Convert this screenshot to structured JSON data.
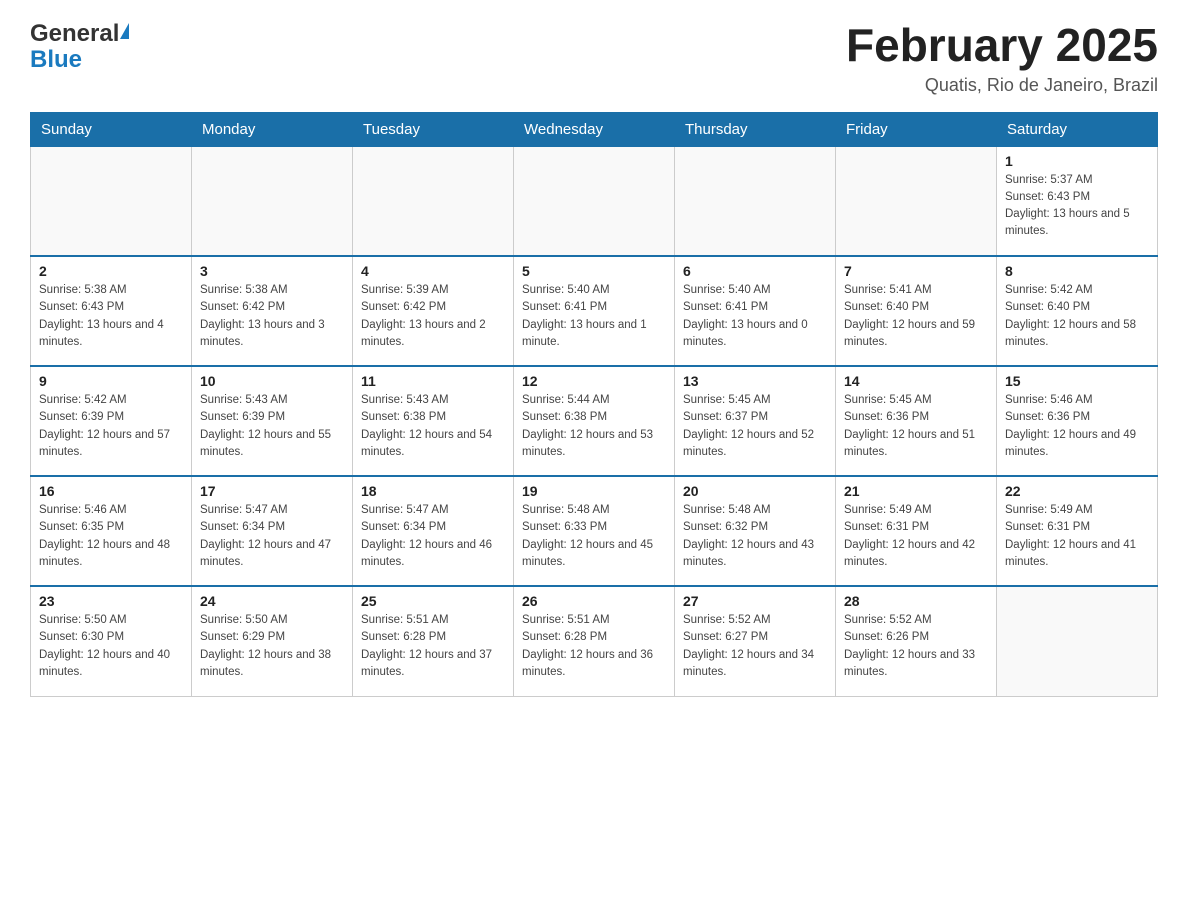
{
  "header": {
    "logo_general": "General",
    "logo_blue": "Blue",
    "month_title": "February 2025",
    "location": "Quatis, Rio de Janeiro, Brazil"
  },
  "days_of_week": [
    "Sunday",
    "Monday",
    "Tuesday",
    "Wednesday",
    "Thursday",
    "Friday",
    "Saturday"
  ],
  "weeks": [
    [
      {
        "day": "",
        "info": ""
      },
      {
        "day": "",
        "info": ""
      },
      {
        "day": "",
        "info": ""
      },
      {
        "day": "",
        "info": ""
      },
      {
        "day": "",
        "info": ""
      },
      {
        "day": "",
        "info": ""
      },
      {
        "day": "1",
        "info": "Sunrise: 5:37 AM\nSunset: 6:43 PM\nDaylight: 13 hours and 5 minutes."
      }
    ],
    [
      {
        "day": "2",
        "info": "Sunrise: 5:38 AM\nSunset: 6:43 PM\nDaylight: 13 hours and 4 minutes."
      },
      {
        "day": "3",
        "info": "Sunrise: 5:38 AM\nSunset: 6:42 PM\nDaylight: 13 hours and 3 minutes."
      },
      {
        "day": "4",
        "info": "Sunrise: 5:39 AM\nSunset: 6:42 PM\nDaylight: 13 hours and 2 minutes."
      },
      {
        "day": "5",
        "info": "Sunrise: 5:40 AM\nSunset: 6:41 PM\nDaylight: 13 hours and 1 minute."
      },
      {
        "day": "6",
        "info": "Sunrise: 5:40 AM\nSunset: 6:41 PM\nDaylight: 13 hours and 0 minutes."
      },
      {
        "day": "7",
        "info": "Sunrise: 5:41 AM\nSunset: 6:40 PM\nDaylight: 12 hours and 59 minutes."
      },
      {
        "day": "8",
        "info": "Sunrise: 5:42 AM\nSunset: 6:40 PM\nDaylight: 12 hours and 58 minutes."
      }
    ],
    [
      {
        "day": "9",
        "info": "Sunrise: 5:42 AM\nSunset: 6:39 PM\nDaylight: 12 hours and 57 minutes."
      },
      {
        "day": "10",
        "info": "Sunrise: 5:43 AM\nSunset: 6:39 PM\nDaylight: 12 hours and 55 minutes."
      },
      {
        "day": "11",
        "info": "Sunrise: 5:43 AM\nSunset: 6:38 PM\nDaylight: 12 hours and 54 minutes."
      },
      {
        "day": "12",
        "info": "Sunrise: 5:44 AM\nSunset: 6:38 PM\nDaylight: 12 hours and 53 minutes."
      },
      {
        "day": "13",
        "info": "Sunrise: 5:45 AM\nSunset: 6:37 PM\nDaylight: 12 hours and 52 minutes."
      },
      {
        "day": "14",
        "info": "Sunrise: 5:45 AM\nSunset: 6:36 PM\nDaylight: 12 hours and 51 minutes."
      },
      {
        "day": "15",
        "info": "Sunrise: 5:46 AM\nSunset: 6:36 PM\nDaylight: 12 hours and 49 minutes."
      }
    ],
    [
      {
        "day": "16",
        "info": "Sunrise: 5:46 AM\nSunset: 6:35 PM\nDaylight: 12 hours and 48 minutes."
      },
      {
        "day": "17",
        "info": "Sunrise: 5:47 AM\nSunset: 6:34 PM\nDaylight: 12 hours and 47 minutes."
      },
      {
        "day": "18",
        "info": "Sunrise: 5:47 AM\nSunset: 6:34 PM\nDaylight: 12 hours and 46 minutes."
      },
      {
        "day": "19",
        "info": "Sunrise: 5:48 AM\nSunset: 6:33 PM\nDaylight: 12 hours and 45 minutes."
      },
      {
        "day": "20",
        "info": "Sunrise: 5:48 AM\nSunset: 6:32 PM\nDaylight: 12 hours and 43 minutes."
      },
      {
        "day": "21",
        "info": "Sunrise: 5:49 AM\nSunset: 6:31 PM\nDaylight: 12 hours and 42 minutes."
      },
      {
        "day": "22",
        "info": "Sunrise: 5:49 AM\nSunset: 6:31 PM\nDaylight: 12 hours and 41 minutes."
      }
    ],
    [
      {
        "day": "23",
        "info": "Sunrise: 5:50 AM\nSunset: 6:30 PM\nDaylight: 12 hours and 40 minutes."
      },
      {
        "day": "24",
        "info": "Sunrise: 5:50 AM\nSunset: 6:29 PM\nDaylight: 12 hours and 38 minutes."
      },
      {
        "day": "25",
        "info": "Sunrise: 5:51 AM\nSunset: 6:28 PM\nDaylight: 12 hours and 37 minutes."
      },
      {
        "day": "26",
        "info": "Sunrise: 5:51 AM\nSunset: 6:28 PM\nDaylight: 12 hours and 36 minutes."
      },
      {
        "day": "27",
        "info": "Sunrise: 5:52 AM\nSunset: 6:27 PM\nDaylight: 12 hours and 34 minutes."
      },
      {
        "day": "28",
        "info": "Sunrise: 5:52 AM\nSunset: 6:26 PM\nDaylight: 12 hours and 33 minutes."
      },
      {
        "day": "",
        "info": ""
      }
    ]
  ]
}
